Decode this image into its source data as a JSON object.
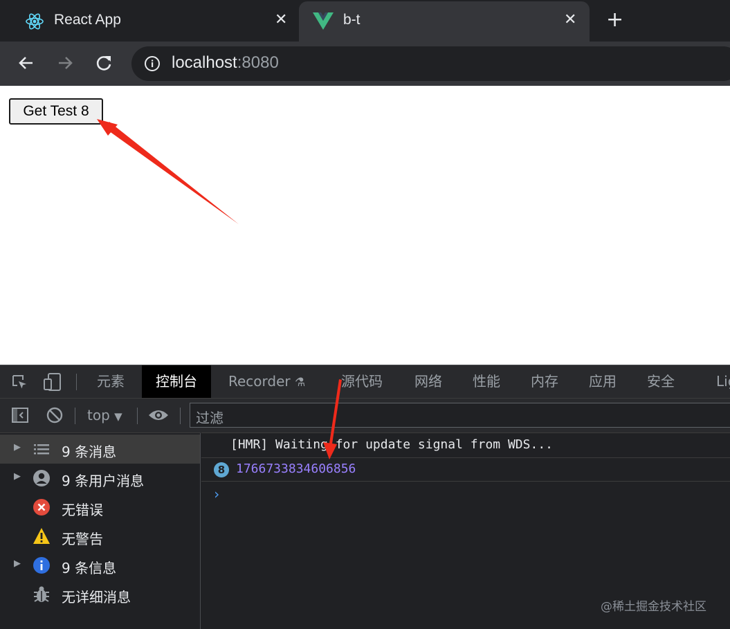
{
  "browser": {
    "tabs": [
      {
        "title": "React App",
        "icon": "react-icon",
        "active": false
      },
      {
        "title": "b-t",
        "icon": "vue-icon",
        "active": true
      }
    ],
    "address": {
      "host": "localhost",
      "port": ":8080"
    }
  },
  "page": {
    "button_label": "Get Test 8"
  },
  "devtools": {
    "tabs": [
      "元素",
      "控制台",
      "Recorder",
      "源代码",
      "网络",
      "性能",
      "内存",
      "应用",
      "安全",
      "Lig"
    ],
    "active_tab": "控制台",
    "context": "top",
    "filter_placeholder": "过滤",
    "sidebar": [
      {
        "label": "9 条消息",
        "icon": "list-icon",
        "expandable": true
      },
      {
        "label": "9 条用户消息",
        "icon": "user-icon",
        "expandable": true
      },
      {
        "label": "无错误",
        "icon": "error-icon",
        "expandable": false
      },
      {
        "label": "无警告",
        "icon": "warning-icon",
        "expandable": false
      },
      {
        "label": "9 条信息",
        "icon": "info-icon",
        "expandable": true
      },
      {
        "label": "无详细消息",
        "icon": "bug-icon",
        "expandable": false
      }
    ],
    "console": {
      "lines": [
        {
          "text": "[HMR] Waiting for update signal from WDS..."
        },
        {
          "repeat": "8",
          "text": "1766733834606856"
        }
      ],
      "prompt": "›"
    }
  },
  "watermark": "@稀土掘金技术社区",
  "colors": {
    "annotation_arrow": "#ee2a1b",
    "number_value": "#9980ff",
    "prompt": "#4d9bf0"
  }
}
